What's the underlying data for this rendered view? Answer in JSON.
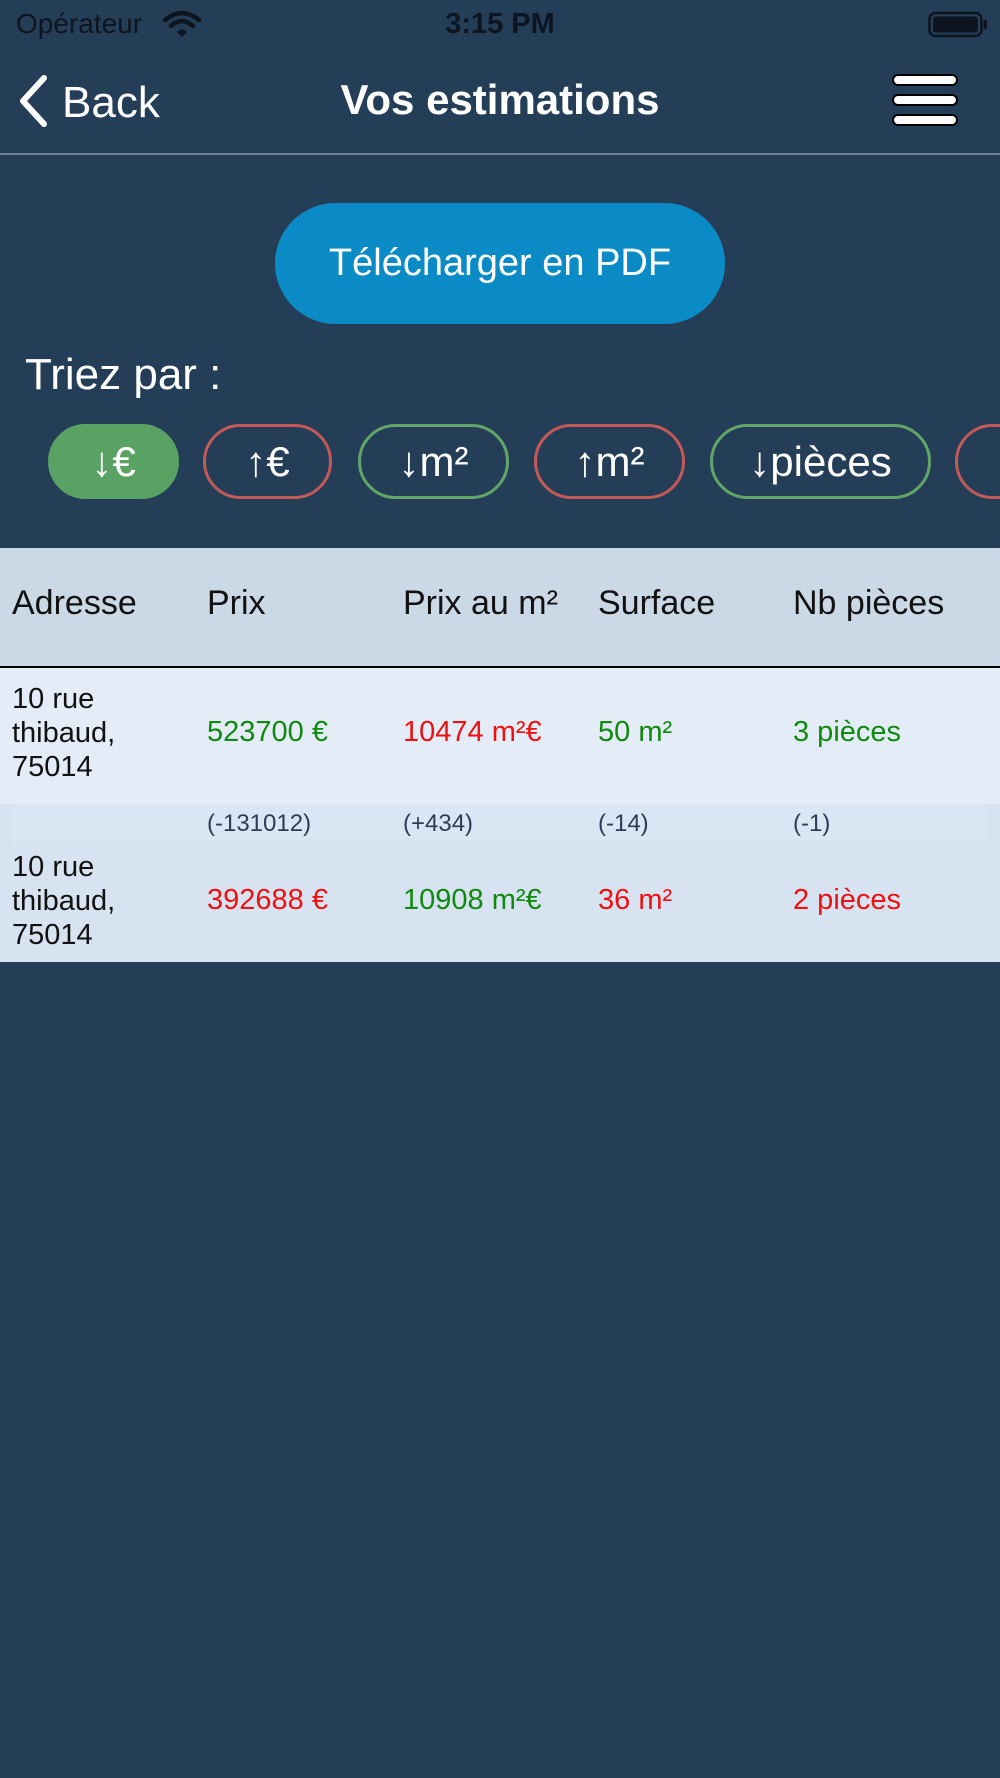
{
  "status_bar": {
    "carrier": "Opérateur",
    "time": "3:15 PM"
  },
  "nav": {
    "back_label": "Back",
    "title": "Vos estimations"
  },
  "pdf_button_label": "Télécharger en PDF",
  "sort": {
    "label": "Triez par :",
    "chips": [
      "↓€",
      "↑€",
      "↓m²",
      "↑m²",
      "↓pièces"
    ],
    "active": "↓€"
  },
  "table": {
    "headers": [
      "Adresse",
      "Prix",
      "Prix au m²",
      "Surface",
      "Nb pièces"
    ],
    "rows": [
      {
        "address": [
          "10 rue",
          "thibaud,",
          "75014"
        ],
        "price": "523700 €",
        "price_m2": "10474 m²€",
        "surface": "50 m²",
        "rooms": "3 pièces"
      },
      {
        "address": [
          "10 rue",
          "thibaud,",
          "75014"
        ],
        "price": "392688 €",
        "price_m2": "10908 m²€",
        "surface": "36 m²",
        "rooms": "2 pièces"
      }
    ],
    "deltas": [
      "(-131012)",
      "(+434)",
      "(-14)",
      "(-1)"
    ]
  },
  "colors": {
    "background": "#253e58",
    "primary_button": "#0a8bc6",
    "chip_active": "#5aa164",
    "chip_green_border": "#62a569",
    "chip_red_border": "#c35a57",
    "value_green": "#0f8a0f",
    "value_red": "#ee1111"
  }
}
